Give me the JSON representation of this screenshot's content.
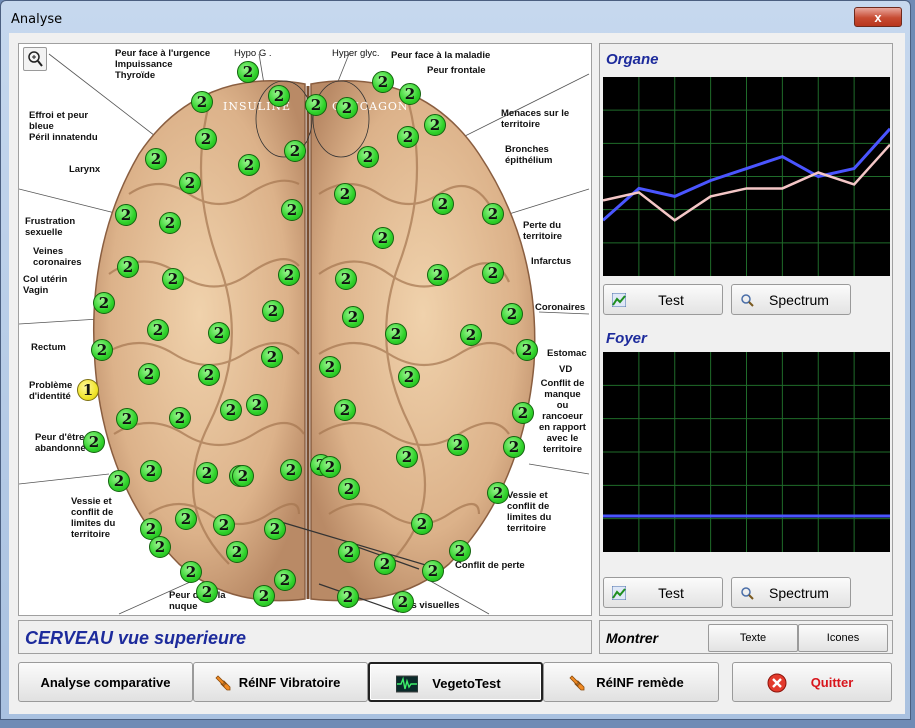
{
  "window": {
    "title": "Analyse",
    "close_glyph": "x"
  },
  "brain": {
    "zoom_icon": "magnifier-icon",
    "labels": {
      "insuline": "INSULINE",
      "glucagon": "GLUCAGON",
      "hypo_glyc": "Hypo G .",
      "hyper_glyc": "Hyper glyc.",
      "urgence": "Peur face à l'urgence\nImpuissance\nThyroïde",
      "maladie": "Peur face à la maladie",
      "frontale": "Peur frontale",
      "effroi": "Effroi et peur\nbleue\nPéril innatendu",
      "menaces": "Menaces sur le\nterritoire",
      "bronches": "Bronches\népithélium",
      "larynx": "Larynx",
      "frustration": "Frustration\nsexuelle",
      "veines": "Veines\ncoronaires",
      "col": "Col utérin\nVagin",
      "perte_territoire": "Perte du\nterritoire",
      "infarctus": "Infarctus",
      "coronaires": "Coronaires",
      "rectum": "Rectum",
      "estomac": "Estomac",
      "vd": "VD",
      "identite": "Problème\nd'identité",
      "conflit_manque": "Conflit de\nmanque\nou\nrancoeur\nen rapport\navec le\nterritoire",
      "peur_abandonne": "Peur d'être\nabandonné",
      "vessie_left": "Vessie et\nconflit de\nlimites du\nterritoire",
      "vessie_right": "Vessie et\nconflit de\nlimites du\nterritoire",
      "conflit_perte": "Conflit de perte",
      "peur_nuque": "Peur dans la\nnuque",
      "aires_visuelles": "Aires visuelles"
    },
    "marker_green": "2",
    "marker_yellow": "1"
  },
  "caption": "CERVEAU  vue superieure",
  "organe": {
    "title": "Organe",
    "chart_data": {
      "type": "line",
      "series": [
        {
          "color": "#4a55ff",
          "values": [
            0.28,
            0.44,
            0.4,
            0.48,
            0.54,
            0.6,
            0.5,
            0.54,
            0.74
          ]
        },
        {
          "color": "#f4c6c6",
          "values": [
            0.38,
            0.42,
            0.28,
            0.4,
            0.44,
            0.44,
            0.52,
            0.46,
            0.66
          ]
        }
      ],
      "ylim": [
        0,
        1
      ],
      "grid": true
    },
    "test_label": "Test",
    "spectrum_label": "Spectrum"
  },
  "foyer": {
    "title": "Foyer",
    "chart_data": {
      "type": "line",
      "series": [
        {
          "color": "#4a55ff",
          "values": [
            0.18,
            0.18
          ]
        }
      ],
      "ylim": [
        0,
        1
      ],
      "grid": true
    },
    "test_label": "Test",
    "spectrum_label": "Spectrum"
  },
  "montrer": {
    "label": "Montrer",
    "texte": "Texte",
    "icones": "Icones"
  },
  "bottom": {
    "analyse": "Analyse comparative",
    "vibratoire": "RéINF Vibratoire",
    "vegeto": "VegetoTest",
    "remede": "RéINF remède",
    "quitter": "Quitter"
  },
  "colors": {
    "accent": "#1d2b9c",
    "quit": "#d8151c",
    "marker": "#2fd22a"
  }
}
